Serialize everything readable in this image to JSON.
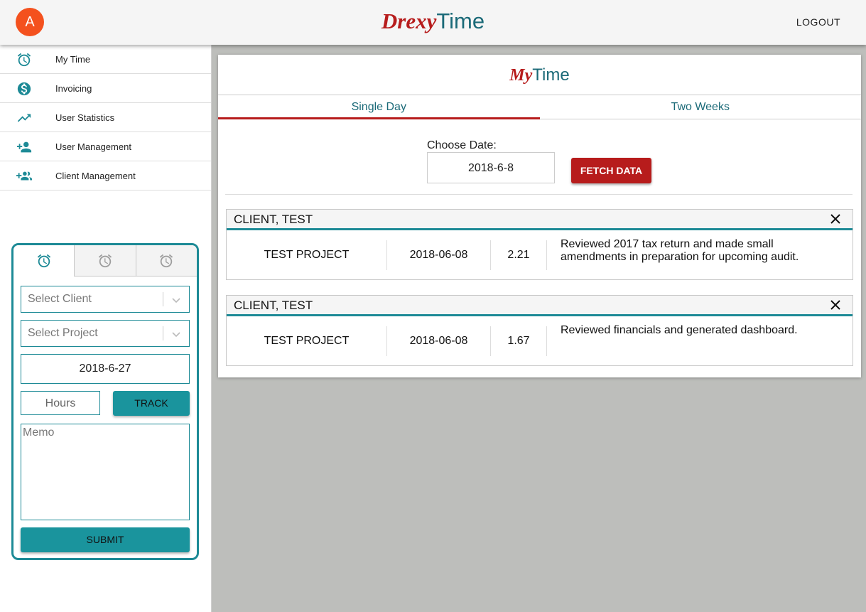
{
  "header": {
    "avatar_letter": "A",
    "brand_part1": "Drexy",
    "brand_part2": "Time",
    "logout_label": "LOGOUT"
  },
  "sidebar": {
    "items": [
      {
        "label": "My Time",
        "icon": "alarm-clock-icon"
      },
      {
        "label": "Invoicing",
        "icon": "dollar-circle-icon"
      },
      {
        "label": "User Statistics",
        "icon": "trending-up-icon"
      },
      {
        "label": "User Management",
        "icon": "person-add-icon"
      },
      {
        "label": "Client Management",
        "icon": "group-add-icon"
      }
    ]
  },
  "tracker": {
    "tabs": [
      "alarm-clock-icon",
      "alarm-clock-icon",
      "alarm-clock-icon"
    ],
    "active_tab": 0,
    "client_placeholder": "Select Client",
    "project_placeholder": "Select Project",
    "date_value": "2018-6-27",
    "hours_placeholder": "Hours",
    "track_label": "TRACK",
    "memo_placeholder": "Memo",
    "submit_label": "SUBMIT"
  },
  "main": {
    "title_part1": "My",
    "title_part2": "Time",
    "tabs": [
      {
        "label": "Single Day",
        "active": true
      },
      {
        "label": "Two Weeks",
        "active": false
      }
    ],
    "choose_date_label": "Choose Date:",
    "date_value": "2018-6-8",
    "fetch_label": "FETCH DATA",
    "entries": [
      {
        "client": "CLIENT, TEST",
        "project": "TEST PROJECT",
        "date": "2018-06-08",
        "hours": "2.21",
        "memo": "Reviewed 2017 tax return and made small amendments in preparation for upcoming audit."
      },
      {
        "client": "CLIENT, TEST",
        "project": "TEST PROJECT",
        "date": "2018-06-08",
        "hours": "1.67",
        "memo": "Reviewed financials and generated dashboard."
      }
    ]
  },
  "colors": {
    "accent_teal": "#1d8a96",
    "brand_red": "#b71c1c",
    "avatar_orange": "#f4511e"
  }
}
